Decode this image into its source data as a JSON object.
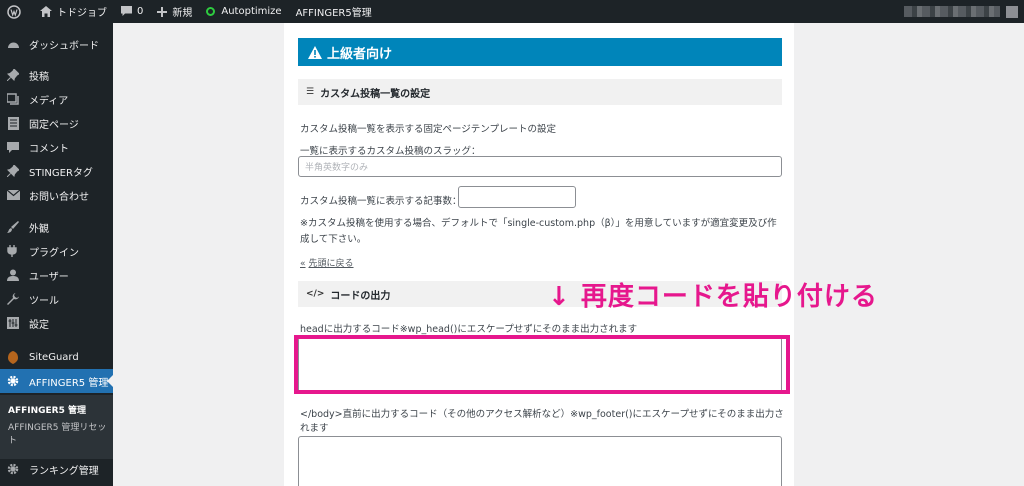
{
  "adminbar": {
    "site_name": "トドジョブ",
    "comment_count": "0",
    "new_label": "新規",
    "autoptimize": "Autoptimize",
    "affinger_admin": "AFFINGER5管理"
  },
  "sidebar": {
    "items": [
      {
        "label": "ダッシュボード",
        "icon": "dashboard-icon"
      },
      {
        "label": "投稿",
        "icon": "pin-icon"
      },
      {
        "label": "メディア",
        "icon": "media-icon"
      },
      {
        "label": "固定ページ",
        "icon": "page-icon"
      },
      {
        "label": "コメント",
        "icon": "comment-icon"
      },
      {
        "label": "STINGERタグ",
        "icon": "pin-icon"
      },
      {
        "label": "お問い合わせ",
        "icon": "mail-icon"
      },
      {
        "label": "外観",
        "icon": "brush-icon"
      },
      {
        "label": "プラグイン",
        "icon": "plugin-icon"
      },
      {
        "label": "ユーザー",
        "icon": "user-icon"
      },
      {
        "label": "ツール",
        "icon": "wrench-icon"
      },
      {
        "label": "設定",
        "icon": "settings-icon"
      },
      {
        "label": "SiteGuard",
        "icon": "shield-icon"
      },
      {
        "label": "AFFINGER5 管理",
        "icon": "gear-icon"
      },
      {
        "label": "ランキング管理",
        "icon": "gear-icon"
      }
    ],
    "submenu": {
      "title": "AFFINGER5 管理",
      "link": "AFFINGER5 管理リセット"
    }
  },
  "main": {
    "header": "上級者向け",
    "custom_section": {
      "title": "カスタム投稿一覧の設定",
      "description": "カスタム投稿一覧を表示する固定ページテンプレートの設定",
      "slug_label": "一覧に表示するカスタム投稿のスラッグ：",
      "slug_placeholder": "半角英数字のみ",
      "count_label": "カスタム投稿一覧に表示する記事数：",
      "count_value": "",
      "note": "※カスタム投稿を使用する場合、デフォルトで「single-custom.php（β）」を用意していますが適宜変更及び作成して下さい。",
      "back_to_top": "先頭に戻る"
    },
    "code_section": {
      "title": "コードの出力",
      "head_label": "headに出力するコード※wp_head()にエスケープせずにそのまま出力されます",
      "footer_label": "</body>直前に出力するコード（その他のアクセス解析など）※wp_footer()にエスケープせずにそのまま出力されます"
    }
  },
  "annotation": {
    "text": "↓ 再度コードを貼り付ける",
    "color": "#e6178d"
  },
  "colors": {
    "adminbar": "#1d2327",
    "active_menu": "#2271b1",
    "header_bar": "#0085ba"
  }
}
